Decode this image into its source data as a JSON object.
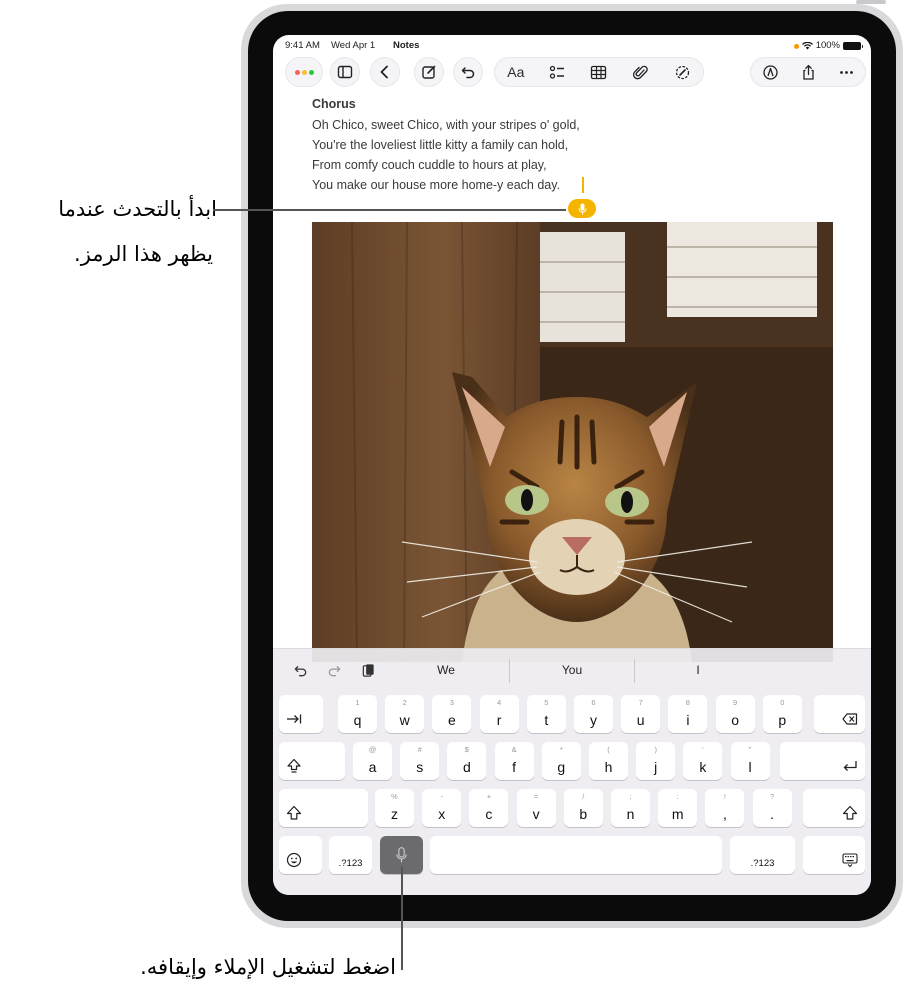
{
  "status_bar": {
    "time": "9:41 AM",
    "date": "Wed Apr 1",
    "app": "Notes",
    "battery": "100%"
  },
  "note": {
    "heading": "Chorus",
    "lines": [
      "Oh Chico, sweet Chico, with your stripes o' gold,",
      "You're the loveliest little kitty a family can hold,",
      "From comfy couch cuddle to hours at play,",
      "You make our house more home-y each day."
    ]
  },
  "toolbar": {
    "format_label": "Aa"
  },
  "keyboard": {
    "predictions": [
      "We",
      "You",
      "I"
    ],
    "row1": [
      {
        "main": "q",
        "sub": "1"
      },
      {
        "main": "w",
        "sub": "2"
      },
      {
        "main": "e",
        "sub": "3"
      },
      {
        "main": "r",
        "sub": "4"
      },
      {
        "main": "t",
        "sub": "5"
      },
      {
        "main": "y",
        "sub": "6"
      },
      {
        "main": "u",
        "sub": "7"
      },
      {
        "main": "i",
        "sub": "8"
      },
      {
        "main": "o",
        "sub": "9"
      },
      {
        "main": "p",
        "sub": "0"
      }
    ],
    "row2": [
      {
        "main": "a",
        "sub": "@"
      },
      {
        "main": "s",
        "sub": "#"
      },
      {
        "main": "d",
        "sub": "$"
      },
      {
        "main": "f",
        "sub": "&"
      },
      {
        "main": "g",
        "sub": "*"
      },
      {
        "main": "h",
        "sub": "("
      },
      {
        "main": "j",
        "sub": ")"
      },
      {
        "main": "k",
        "sub": "'"
      },
      {
        "main": "l",
        "sub": "\""
      }
    ],
    "row3": [
      {
        "main": "z",
        "sub": "%"
      },
      {
        "main": "x",
        "sub": "-"
      },
      {
        "main": "c",
        "sub": "+"
      },
      {
        "main": "v",
        "sub": "="
      },
      {
        "main": "b",
        "sub": "/"
      },
      {
        "main": "n",
        "sub": ";"
      },
      {
        "main": "m",
        "sub": ":"
      },
      {
        "main": ",",
        "sub": "!"
      },
      {
        "main": ".",
        "sub": "?"
      }
    ],
    "numbers_label_left": ".?123",
    "numbers_label_right": ".?123"
  },
  "callouts": {
    "dictation_icon_line1": "ابدأ بالتحدث عندما",
    "dictation_icon_line2": "يظهر هذا الرمز.",
    "mic_key": "اضغط لتشغيل الإملاء وإيقافه."
  },
  "colors": {
    "dictation_accent": "#f5b400",
    "mic_key_active": "#6b6b6e"
  }
}
